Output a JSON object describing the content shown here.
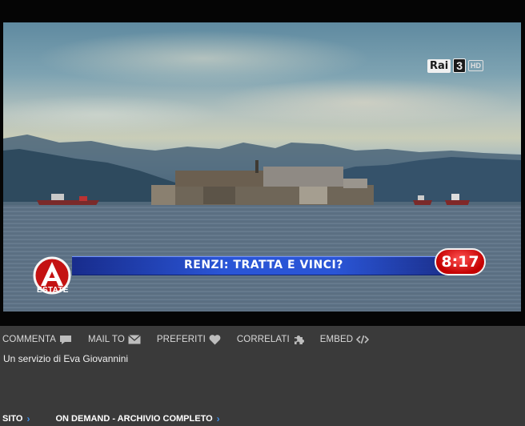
{
  "video": {
    "channel_logo": "Rai",
    "channel_number": "3",
    "hd_badge": "HD",
    "show_logo_text": "ESTATE",
    "ticker_headline": "RENZI: TRATTA E VINCI?",
    "clock_time": "8:17",
    "colors": {
      "ticker": "#2a55d6",
      "clock": "#d40000",
      "chevron": "#3e8ee6"
    }
  },
  "toolbar": {
    "items": [
      {
        "label": "COMMENTA",
        "icon": "comment-icon"
      },
      {
        "label": "MAIL TO",
        "icon": "mail-icon"
      },
      {
        "label": "PREFERITI",
        "icon": "heart-icon"
      },
      {
        "label": "CORRELATI",
        "icon": "puzzle-icon"
      },
      {
        "label": "EMBED",
        "icon": "code-icon"
      }
    ]
  },
  "description": "Un servizio di Eva Giovannini",
  "footer": {
    "links": [
      {
        "label": "SITO",
        "chevron": "›"
      },
      {
        "label": "ON DEMAND - ARCHIVIO COMPLETO",
        "chevron": "›"
      }
    ]
  }
}
